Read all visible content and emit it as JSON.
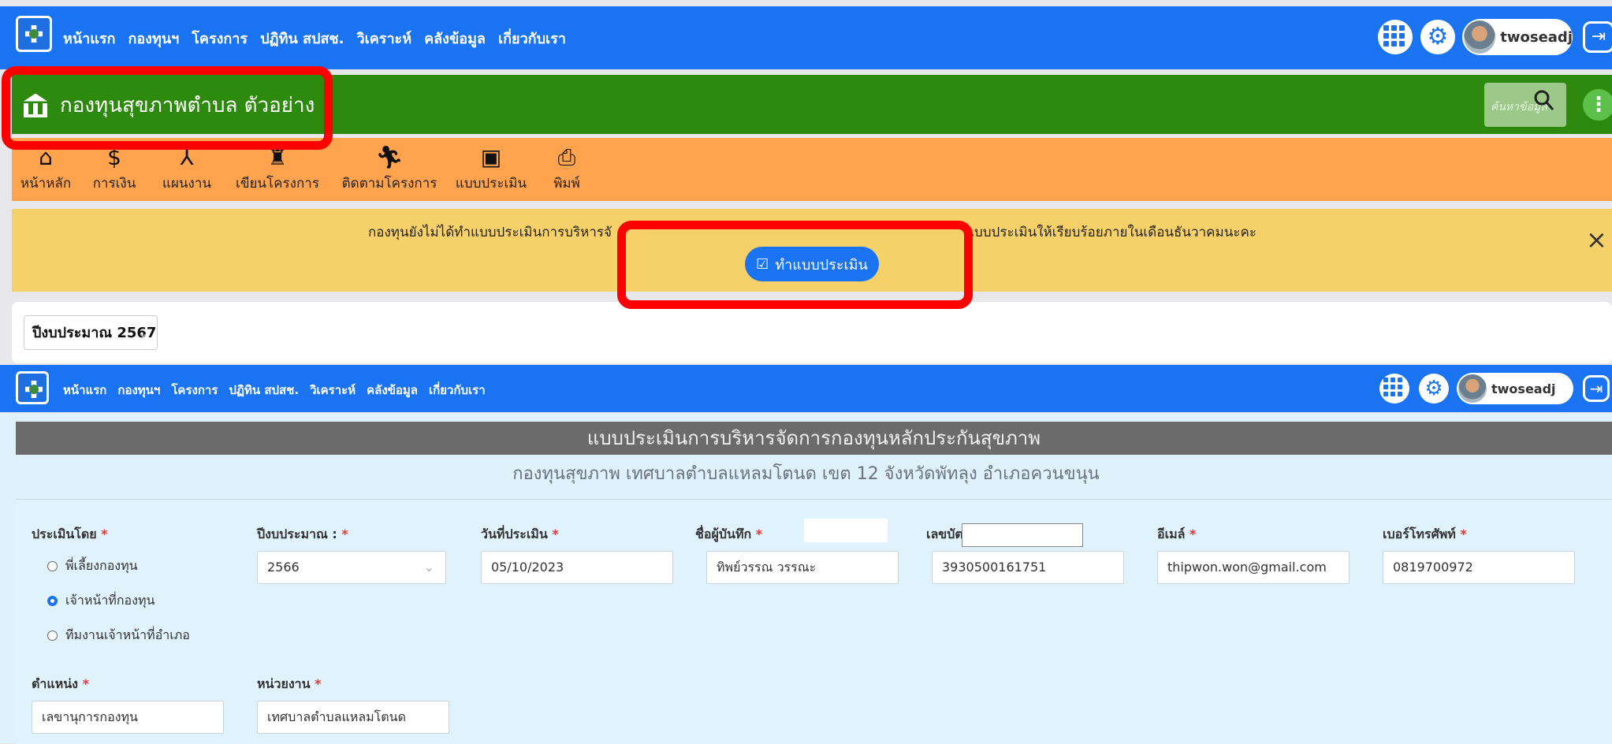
{
  "nav": {
    "items": [
      "หน้าแรก",
      "กองทุนฯ",
      "โครงการ",
      "ปฏิทิน สปสช.",
      "วิเคราะห์",
      "คลังข้อมูล",
      "เกี่ยวกับเรา"
    ],
    "username": "twoseadj"
  },
  "fund": {
    "title": "กองทุนสุขภาพตำบล ตัวอย่าง",
    "search_placeholder": "ค้นหาข้อมูล"
  },
  "toolbar": {
    "items": [
      {
        "label": "หน้าหลัก",
        "icon": "home-icon"
      },
      {
        "label": "การเงิน",
        "icon": "dollar-icon"
      },
      {
        "label": "แผนงาน",
        "icon": "sitemap-icon"
      },
      {
        "label": "เขียนโครงการ",
        "icon": "write-project-icon"
      },
      {
        "label": "ติดตามโครงการ",
        "icon": "walk-icon"
      },
      {
        "label": "แบบประเมิน",
        "icon": "chart-icon"
      },
      {
        "label": "พิมพ์",
        "icon": "print-icon"
      }
    ]
  },
  "alert": {
    "text_left": "กองทุนยังไม่ได้ทำแบบประเมินการบริหารจั",
    "text_right": "แบบประเมินให้เรียบร้อยภายในเดือนธันวาคมนะคะ",
    "button_label": "ทำแบบประเมิน",
    "close": "×"
  },
  "year_select": {
    "value": "ปีงบประมาณ 2567"
  },
  "form": {
    "title": "แบบประเมินการบริหารจัดการกองทุนหลักประกันสุขภาพ",
    "subtitle": "กองทุนสุขภาพ เทศบาลตำบลแหลมโตนด เขต 12 จังหวัดพัทลุง อำเภอควนขนุน",
    "labels": {
      "assessed_by": "ประเมินโดย",
      "fiscal_year": "ปีงบประมาณ :",
      "assess_date": "วันที่ประเมิน",
      "recorder": "ชื่อผู้บันทึก",
      "id_number": "เลขบัตรประชาชน",
      "email": "อีเมล์",
      "phone": "เบอร์โทรศัพท์",
      "position": "ตำแหน่ง",
      "agency": "หน่วยงาน"
    },
    "radio_options": [
      "พี่เลี้ยงกองทุน",
      "เจ้าหน้าที่กองทุน",
      "ทีมงานเจ้าหน้าที่อำเภอ"
    ],
    "values": {
      "fiscal_year": "2566",
      "assess_date": "05/10/2023",
      "recorder": "ทิพย์วรรณ วรรณะ",
      "id_number": "3930500161751",
      "email": "thipwon.won@gmail.com",
      "phone": "0819700972",
      "position": "เลขานุการกองทุน",
      "agency": "เทศบาลตำบลแหลมโตนด"
    }
  }
}
